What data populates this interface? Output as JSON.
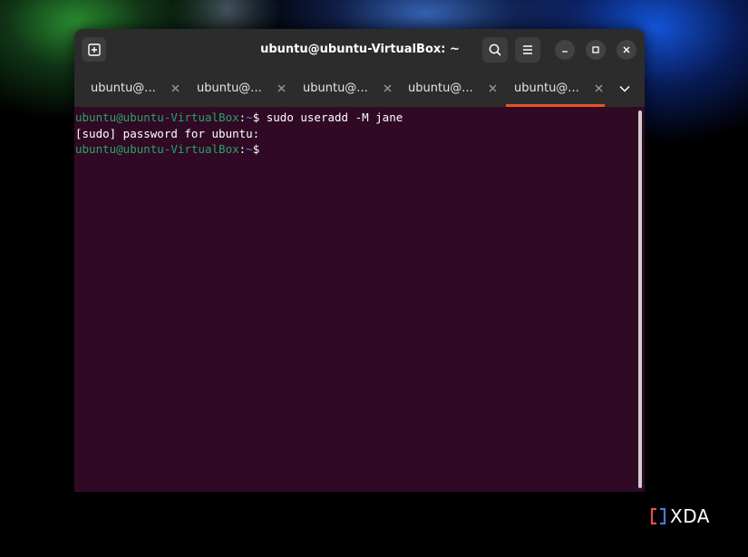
{
  "window": {
    "title": "ubuntu@ubuntu-VirtualBox: ~"
  },
  "tabs": [
    {
      "label": "ubuntu@...",
      "active": false
    },
    {
      "label": "ubuntu@...",
      "active": false
    },
    {
      "label": "ubuntu@...",
      "active": false
    },
    {
      "label": "ubuntu@...",
      "active": false
    },
    {
      "label": "ubuntu@...",
      "active": true
    }
  ],
  "terminal": {
    "lines": [
      {
        "user": "ubuntu@ubuntu-VirtualBox",
        "sep": ":",
        "path": "~",
        "symbol": "$ ",
        "command": "sudo useradd -M jane"
      },
      {
        "text": "[sudo] password for ubuntu:"
      },
      {
        "user": "ubuntu@ubuntu-VirtualBox",
        "sep": ":",
        "path": "~",
        "symbol": "$",
        "command": ""
      }
    ]
  },
  "watermark": {
    "text": "XDA"
  },
  "colors": {
    "accent": "#e95420",
    "terminal_bg": "#300a24",
    "prompt_user": "#26a269",
    "prompt_path": "#4a8ad8"
  },
  "icons": {
    "new_tab": "new-tab-icon",
    "search": "search-icon",
    "menu": "hamburger-menu-icon",
    "minimize": "minimize-icon",
    "maximize": "maximize-icon",
    "close": "close-icon",
    "tab_close": "close-icon",
    "tab_list": "chevron-down-icon"
  }
}
